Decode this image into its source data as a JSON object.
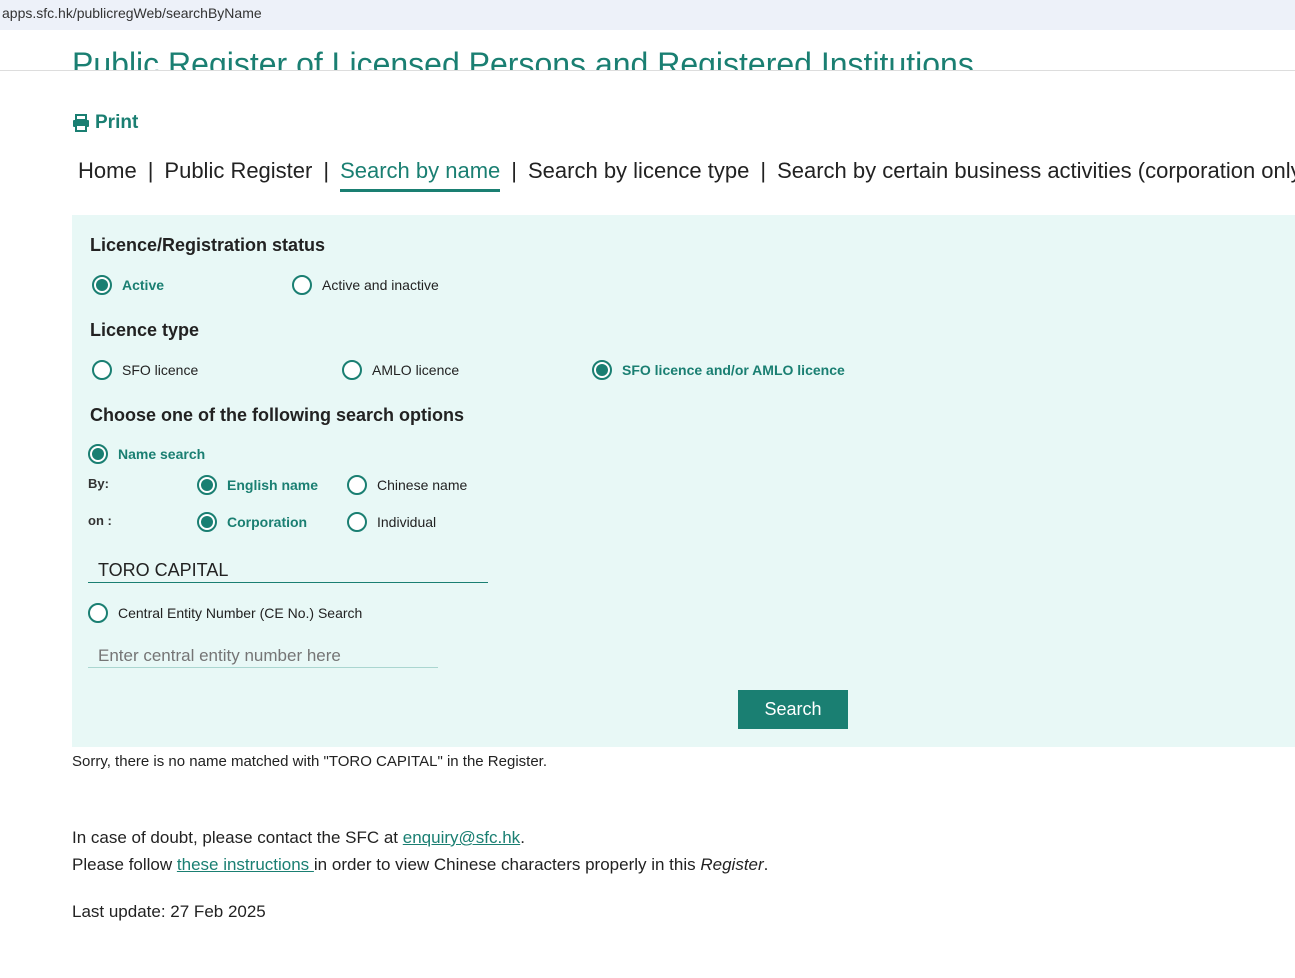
{
  "browser": {
    "url": "apps.sfc.hk/publicregWeb/searchByName"
  },
  "page_title": "Public Register of Licensed Persons and Registered Institutions",
  "print_label": "Print",
  "nav": [
    "Home",
    "Public Register",
    "Search by name",
    "Search by licence type",
    "Search by certain business activities (corporation only)"
  ],
  "nav_separator": "|",
  "status": {
    "heading": "Licence/Registration status",
    "options": [
      "Active",
      "Active and inactive"
    ],
    "selected": "Active"
  },
  "licence_type": {
    "heading": "Licence type",
    "options": [
      "SFO licence",
      "AMLO licence",
      "SFO licence and/or AMLO licence"
    ],
    "selected": "SFO licence and/or AMLO licence"
  },
  "search_options": {
    "heading": "Choose one of the following search options",
    "name_search": "Name search",
    "by_label": "By:",
    "by_options": [
      "English name",
      "Chinese name"
    ],
    "on_label": "on :",
    "on_options": [
      "Corporation",
      "Individual"
    ],
    "name_value": "TORO CAPITAL",
    "ce_search": "Central Entity Number (CE No.) Search",
    "ce_placeholder": "Enter central entity number here"
  },
  "search_button": "Search",
  "result_message": "Sorry, there is no name matched with \"TORO CAPITAL\" in the Register.",
  "footer": {
    "doubt_prefix": "In case of doubt, please contact the SFC at ",
    "email": "enquiry@sfc.hk",
    "doubt_suffix": ".",
    "follow_prefix": "Please follow ",
    "instructions_link": "these instructions ",
    "follow_middle": "in order to view Chinese characters properly in this ",
    "register_word": "Register",
    "follow_suffix": ".",
    "last_update": "Last update: 27 Feb 2025"
  },
  "colors": {
    "accent": "#1a7f72",
    "panel": "#e8f8f6"
  }
}
